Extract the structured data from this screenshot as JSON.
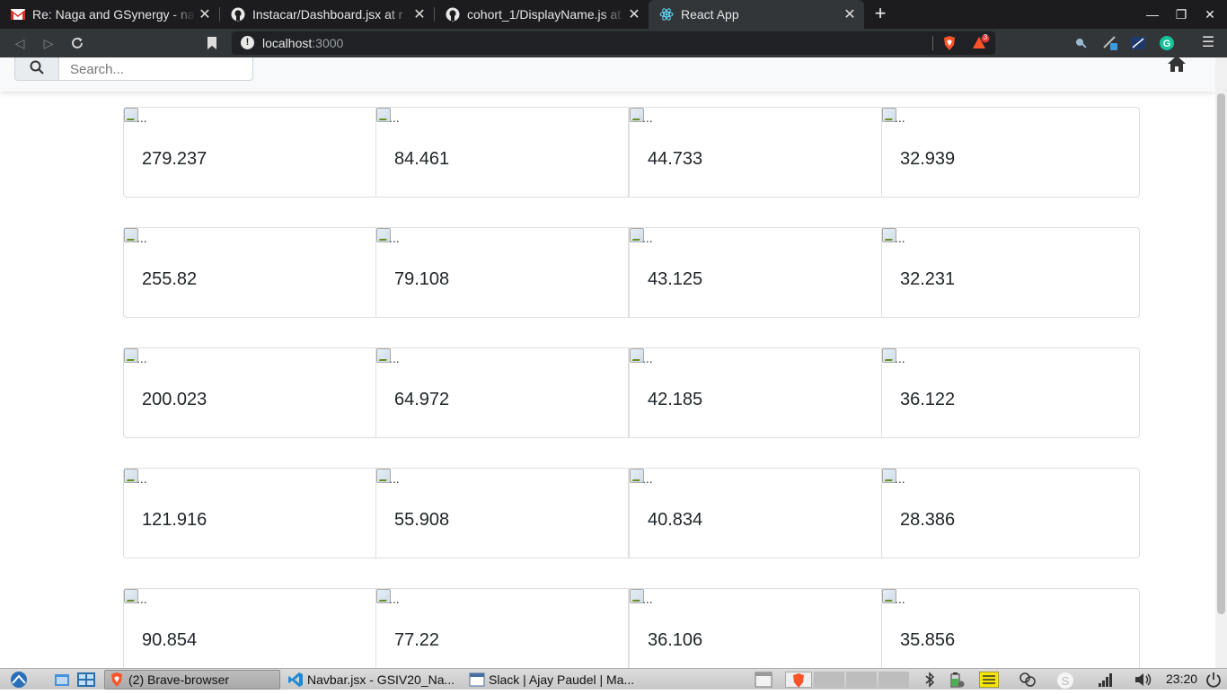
{
  "browser": {
    "tabs": [
      {
        "title": "Re: Naga and GSynergy - na",
        "icon": "gmail-icon",
        "active": false
      },
      {
        "title": "Instacar/Dashboard.jsx at r",
        "icon": "github-icon",
        "active": false
      },
      {
        "title": "cohort_1/DisplayName.js at",
        "icon": "github-icon",
        "active": false
      },
      {
        "title": "React App",
        "icon": "react-icon",
        "active": true
      }
    ],
    "url_host": "localhost",
    "url_port": ":3000",
    "notification_badge": "3"
  },
  "app": {
    "search_placeholder": "Search...",
    "image_alt": "...",
    "cards": [
      [
        "279.237",
        "84.461",
        "44.733",
        "32.939"
      ],
      [
        "255.82",
        "79.108",
        "43.125",
        "32.231"
      ],
      [
        "200.023",
        "64.972",
        "42.185",
        "36.122"
      ],
      [
        "121.916",
        "55.908",
        "40.834",
        "28.386"
      ],
      [
        "90.854",
        "77.22",
        "36.106",
        "35.856"
      ]
    ]
  },
  "taskbar": {
    "items": [
      {
        "label": "(2) Brave-browser",
        "icon": "brave-icon"
      },
      {
        "label": "Navbar.jsx - GSIV20_Na...",
        "icon": "vscode-icon"
      },
      {
        "label": "Slack | Ajay Paudel | Ma...",
        "icon": "window-icon"
      }
    ],
    "clock": "23:20"
  }
}
